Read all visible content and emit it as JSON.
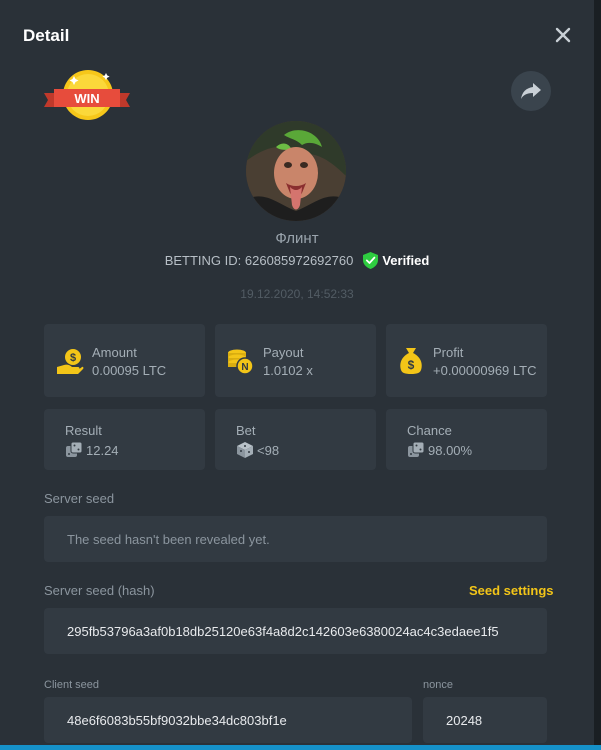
{
  "modal": {
    "title": "Detail"
  },
  "badge": {
    "text": "WIN"
  },
  "player": {
    "name": "Флинт",
    "betting_id": "BETTING ID: 626085972692760",
    "verified_label": "Verified",
    "timestamp": "19.12.2020, 14:52:33"
  },
  "stats": {
    "amount": {
      "label": "Amount",
      "value": "0.00095 LTC"
    },
    "payout": {
      "label": "Payout",
      "value": "1.0102 x"
    },
    "profit": {
      "label": "Profit",
      "value": "+0.00000969 LTC"
    },
    "result": {
      "label": "Result",
      "value": "12.24"
    },
    "bet": {
      "label": "Bet",
      "value": "<98"
    },
    "chance": {
      "label": "Chance",
      "value": "98.00%"
    }
  },
  "server_seed": {
    "label": "Server seed",
    "value": "The seed hasn't been revealed yet."
  },
  "server_seed_hash": {
    "label": "Server seed (hash)",
    "settings_link": "Seed settings",
    "value": "295fb53796a3af0b18db25120e63f4a8d2c142603e6380024ac4c3edaee1f5"
  },
  "client_seed": {
    "label": "Client seed",
    "value": "48e6f6083b55bf9032bbe34dc803bf1e"
  },
  "nonce": {
    "label": "nonce",
    "value": "20248"
  },
  "colors": {
    "accent_yellow": "#f3c518",
    "verified_green": "#2ecc40",
    "panel_bg": "#2a3138",
    "card_bg": "#323a42"
  },
  "icons": {
    "close": "close-icon",
    "share": "share-arrow-icon",
    "verified": "shield-check-icon",
    "amount": "hand-coin-icon",
    "payout": "coin-stack-icon",
    "profit": "money-bag-icon",
    "result": "dice-icon",
    "bet": "dice-cube-icon",
    "chance": "dice-icon"
  }
}
